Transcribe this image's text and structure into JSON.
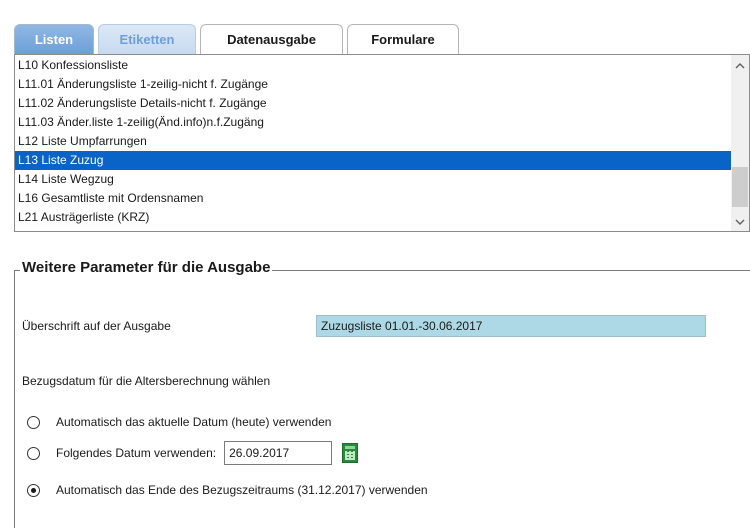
{
  "tabs": [
    {
      "label": "Listen"
    },
    {
      "label": "Etiketten"
    },
    {
      "label": "Datenausgabe"
    },
    {
      "label": "Formulare"
    }
  ],
  "list": {
    "items": [
      "L10 Konfessionsliste",
      "L11.01 Änderungsliste 1-zeilig-nicht f. Zugänge",
      "L11.02 Änderungsliste Details-nicht f. Zugänge",
      "L11.03 Änder.liste 1-zeilig(Änd.info)n.f.Zugäng",
      "L12 Liste Umpfarrungen",
      "L13 Liste Zuzug",
      "L14 Liste Wegzug",
      "L16 Gesamtliste mit Ordensnamen",
      "L21 Austrägerliste (KRZ)"
    ],
    "selected": "L13 Liste Zuzug"
  },
  "params": {
    "legend": "Weitere Parameter für die Ausgabe",
    "headline_label": "Überschrift auf der Ausgabe",
    "headline_value": "Zuzugsliste 01.01.-30.06.2017",
    "ref_date_label": "Bezugsdatum für die Altersberechnung wählen",
    "options": {
      "today": "Automatisch das aktuelle Datum (heute) verwenden",
      "fixed": "Folgendes Datum verwenden:",
      "period_end": "Automatisch das Ende des Bezugszeitraums (31.12.2017) verwenden"
    },
    "fixed_date": "26.09.2017",
    "selected_option": "period_end"
  },
  "colors": {
    "selection": "#0a64c8",
    "tab_active_bg": "#ffffff",
    "tab_inactive_bg": "#6d9fd8",
    "headline_input_bg": "#add8e6",
    "calendar_icon": "#2a8a3c"
  },
  "icons": {
    "scroll_up": "chevron-up-icon",
    "scroll_down": "chevron-down-icon",
    "calendar": "calendar-icon"
  }
}
